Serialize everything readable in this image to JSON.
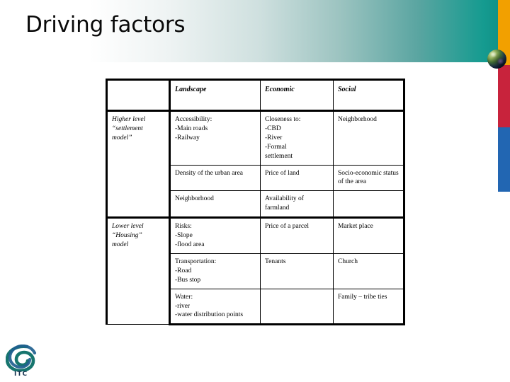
{
  "slide": {
    "title": "Driving factors"
  },
  "branding": {
    "logo_text": "ITC",
    "globe_icon": "globe-icon",
    "accent_colors": {
      "teal": "#119288",
      "orange": "#F2A000",
      "red": "#C8233C",
      "blue": "#2266B2",
      "logo_teal": "#17756e",
      "logo_navy": "#14324f"
    }
  },
  "table": {
    "columns": [
      "",
      "Landscape",
      "Economic",
      "Social"
    ],
    "sections": [
      {
        "label": "Higher level\n“settlement\nmodel”",
        "rows": [
          {
            "landscape": "Accessibility:\n-Main roads\n-Railway",
            "economic": "Closeness to:\n-CBD\n-River\n-Formal\nsettlement",
            "social": "Neighborhood"
          },
          {
            "landscape": "Density of the urban area",
            "economic": "Price of land",
            "social": "Socio-economic status of the area"
          },
          {
            "landscape": "Neighborhood",
            "economic": "Availability of farmland",
            "social": ""
          }
        ]
      },
      {
        "label": "Lower level\n“Housing”\nmodel",
        "rows": [
          {
            "landscape": "Risks:\n-Slope\n-flood area",
            "economic": "Price of a parcel",
            "social": "Market place"
          },
          {
            "landscape": "Transportation:\n-Road\n-Bus stop",
            "economic": "Tenants",
            "social": "Church"
          },
          {
            "landscape": "Water:\n-river\n-water distribution points",
            "economic": "",
            "social": "Family – tribe ties"
          }
        ]
      }
    ]
  }
}
